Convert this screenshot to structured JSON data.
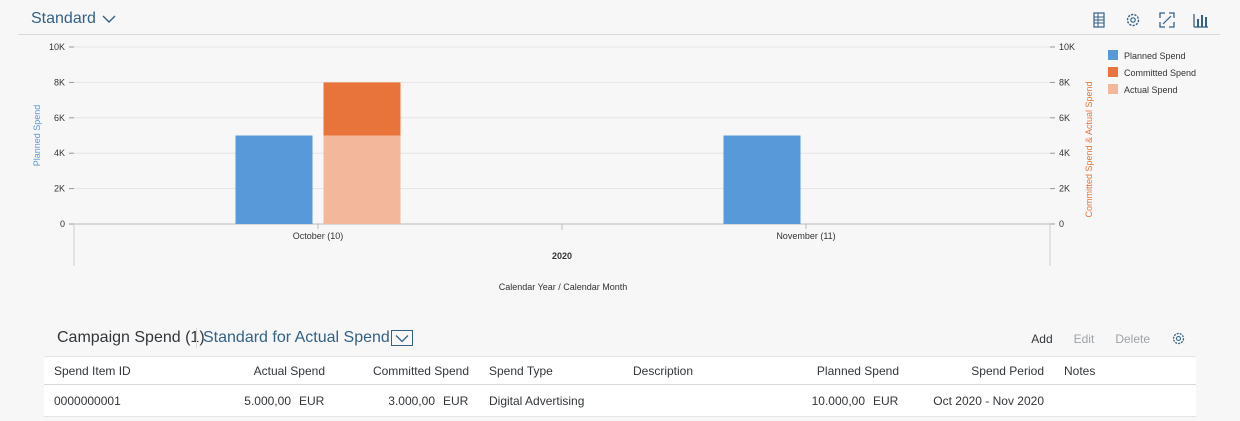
{
  "chart_header": {
    "variant_label": "Standard",
    "tools": [
      "table-view-icon",
      "settings-icon",
      "fullscreen-icon",
      "chart-type-icon"
    ]
  },
  "chart_data": {
    "type": "bar",
    "x_axis_label": "Calendar Year / Calendar Month",
    "x_group_label": "2020",
    "categories": [
      "October (10)",
      "November (11)"
    ],
    "y_left": {
      "label": "Planned Spend",
      "ticks": [
        "0",
        "2K",
        "4K",
        "6K",
        "8K",
        "10K"
      ],
      "range": [
        0,
        10000
      ]
    },
    "y_right": {
      "label": "Committed Spend & Actual Spend",
      "ticks": [
        "0",
        "2K",
        "4K",
        "6K",
        "8K",
        "10K"
      ],
      "range": [
        0,
        10000
      ]
    },
    "series": [
      {
        "name": "Planned Spend",
        "color": "#5899da",
        "axis": "left",
        "stack": "planned",
        "values": [
          5000,
          5000
        ]
      },
      {
        "name": "Committed Spend",
        "color": "#e8743b",
        "axis": "right",
        "stack": "commit",
        "values": [
          3000,
          0
        ]
      },
      {
        "name": "Actual Spend",
        "color": "#f3b89c",
        "axis": "right",
        "stack": "commit",
        "values": [
          5000,
          0
        ]
      }
    ],
    "legend_position": "top-right",
    "grid": true,
    "left_axis_color": "#5899da",
    "right_axis_color": "#e8743b"
  },
  "table": {
    "title": "Campaign Spend (1)",
    "variant": "Standard for Actual Spend",
    "actions": {
      "add": "Add",
      "edit": "Edit",
      "delete": "Delete"
    },
    "columns": [
      "Spend Item ID",
      "Actual Spend",
      "Committed Spend",
      "Spend Type",
      "Description",
      "Planned Spend",
      "Spend Period",
      "Notes"
    ],
    "rows": [
      {
        "id": "0000000001",
        "actual": "5.000,00",
        "actual_unit": "EUR",
        "committed": "3.000,00",
        "committed_unit": "EUR",
        "type": "Digital Advertising",
        "description": "",
        "planned": "10.000,00",
        "planned_unit": "EUR",
        "period": "Oct 2020 - Nov 2020",
        "notes": ""
      }
    ]
  }
}
